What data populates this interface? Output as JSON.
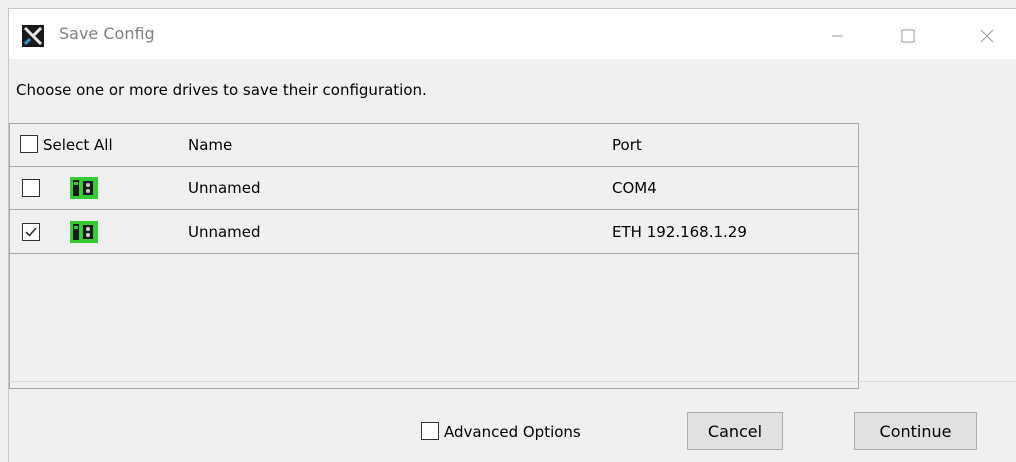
{
  "window": {
    "title": "Save Config",
    "icon": "app-x-logo-icon",
    "controls": [
      "minimize-icon",
      "maximize-icon",
      "close-icon"
    ]
  },
  "instructions": "Choose one or more drives to save their configuration.",
  "table": {
    "header": {
      "select_all_label": "Select All",
      "select_all_checked": false,
      "name_col": "Name",
      "port_col": "Port"
    },
    "rows": [
      {
        "checked": false,
        "icon": "drive-icon",
        "name": "Unnamed",
        "port": "COM4"
      },
      {
        "checked": true,
        "icon": "drive-icon",
        "name": "Unnamed",
        "port": "ETH 192.168.1.29"
      }
    ]
  },
  "footer": {
    "advanced_options_label": "Advanced Options",
    "advanced_options_checked": false,
    "cancel_label": "Cancel",
    "continue_label": "Continue"
  },
  "colors": {
    "drive_icon_green": "#33cc33",
    "title_text": "#808080"
  }
}
